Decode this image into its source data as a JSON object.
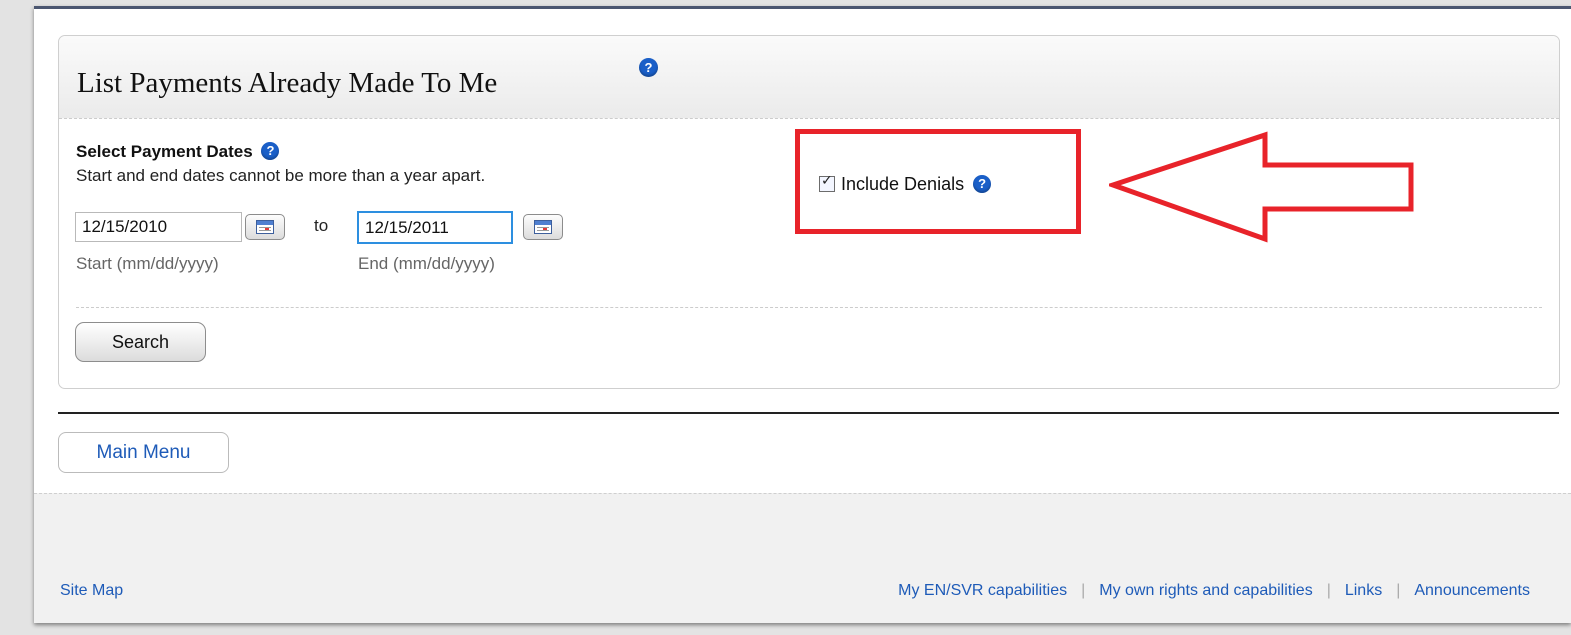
{
  "panel": {
    "title": "List Payments Already Made To Me",
    "help_glyph": "?"
  },
  "dates": {
    "section_label": "Select Payment Dates",
    "description": "Start and end dates cannot be more than a year apart.",
    "start_value": "12/15/2010",
    "end_value": "12/15/2011",
    "to_label": "to",
    "start_hint": "Start (mm/dd/yyyy)",
    "end_hint": "End (mm/dd/yyyy)"
  },
  "options": {
    "include_denials_label": "Include Denials",
    "include_denials_checked": true
  },
  "actions": {
    "search_label": "Search",
    "main_menu_label": "Main Menu"
  },
  "annotation": {
    "highlight_color": "#e8232a"
  },
  "footer": {
    "site_map": "Site Map",
    "links": [
      "My EN/SVR capabilities",
      "My own rights and capabilities",
      "Links",
      "Announcements"
    ]
  },
  "icons": {
    "help": "help-circle-icon",
    "calendar": "calendar-icon",
    "checkbox": "checkbox-checked-icon",
    "arrow": "left-arrow-annotation"
  }
}
